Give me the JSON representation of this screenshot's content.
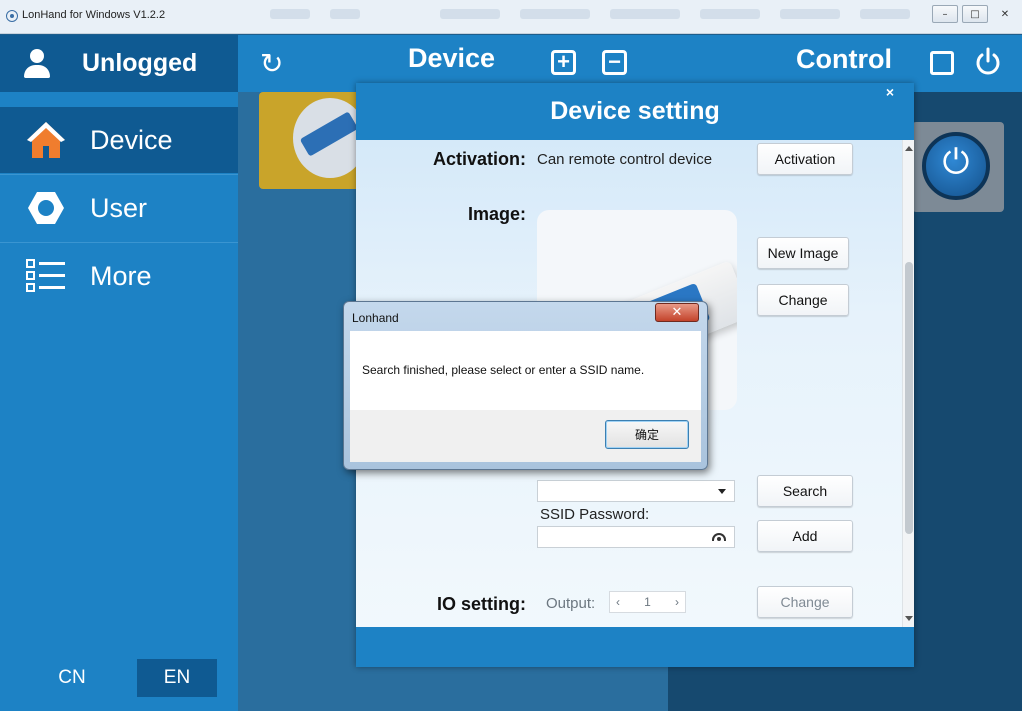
{
  "window": {
    "title": "LonHand for Windows V1.2.2",
    "minimize_glyph": "–",
    "maximize_glyph": "□",
    "close_glyph": "✕"
  },
  "sidebar": {
    "user_label": "Unlogged",
    "items": [
      {
        "label": "Device",
        "icon": "home-icon",
        "active": true
      },
      {
        "label": "User",
        "icon": "gear-icon",
        "active": false
      },
      {
        "label": "More",
        "icon": "list-icon",
        "active": false
      }
    ],
    "lang_cn": "CN",
    "lang_en": "EN"
  },
  "topbar": {
    "refresh_glyph": "↻",
    "device_title": "Device",
    "add_glyph": "+",
    "remove_glyph": "−",
    "control_title": "Control"
  },
  "device_setting": {
    "title": "Device setting",
    "close_glyph": "×",
    "activation_label": "Activation:",
    "activation_text": "Can remote control device",
    "activation_button": "Activation",
    "image_label": "Image:",
    "new_image_button": "New Image",
    "change_button": "Change",
    "search_button": "Search",
    "ssid_password_label": "SSID Password:",
    "add_button": "Add",
    "io_setting_label": "IO setting:",
    "output_label": "Output:",
    "output_value": "1",
    "io_change_button": "Change",
    "stepper_left": "‹",
    "stepper_right": "›"
  },
  "message_box": {
    "title": "Lonhand",
    "close_glyph": "✕",
    "text": "Search finished, please select or enter a SSID name.",
    "ok_button": "确定"
  },
  "colors": {
    "accent_blue": "#1d82c5",
    "dark_blue": "#0f5a92",
    "home_orange": "#f07d2e"
  }
}
